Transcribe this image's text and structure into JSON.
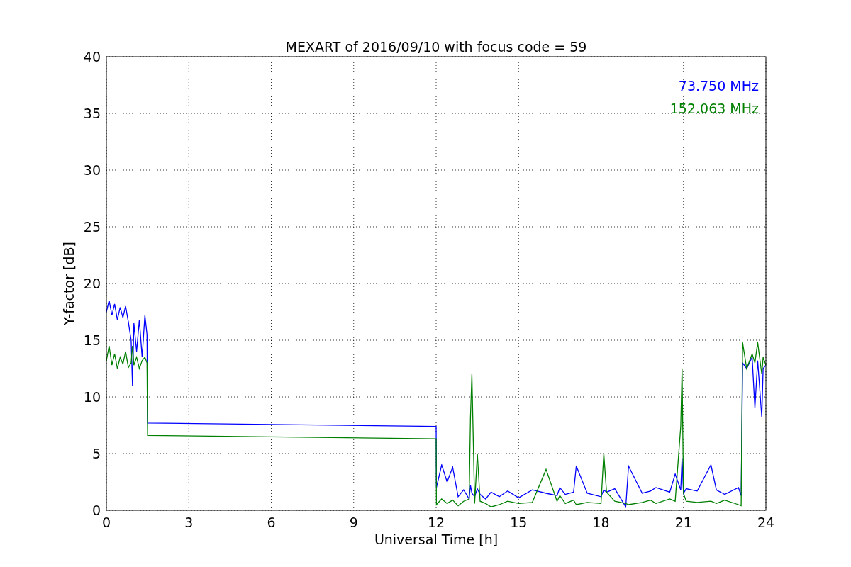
{
  "figure": {
    "chart_data": {
      "type": "line",
      "title": "MEXART of 2016/09/10 with focus code = 59",
      "xlabel": "Universal Time [h]",
      "ylabel": "Y-factor [dB]",
      "grid": true,
      "xlim": [
        0,
        24
      ],
      "ylim": [
        0,
        40
      ],
      "xticks": [
        0,
        3,
        6,
        9,
        12,
        15,
        18,
        21,
        24
      ],
      "yticks": [
        0,
        5,
        10,
        15,
        20,
        25,
        30,
        35,
        40
      ],
      "x": [
        0,
        0.1,
        0.2,
        0.3,
        0.4,
        0.5,
        0.6,
        0.7,
        0.8,
        0.9,
        0.95,
        1.0,
        1.1,
        1.2,
        1.3,
        1.4,
        1.48,
        1.5,
        12.0,
        12.01,
        12.2,
        12.4,
        12.6,
        12.8,
        13.0,
        13.2,
        13.25,
        13.3,
        13.4,
        13.5,
        13.6,
        13.8,
        14.0,
        14.3,
        14.6,
        15.0,
        15.5,
        16.0,
        16.4,
        16.5,
        16.7,
        17.0,
        17.1,
        17.5,
        18.0,
        18.1,
        18.2,
        18.5,
        18.9,
        19.0,
        19.5,
        19.8,
        20.0,
        20.5,
        20.7,
        20.9,
        20.95,
        21.0,
        21.1,
        21.5,
        22.0,
        22.2,
        22.5,
        23.0,
        23.1,
        23.15,
        23.3,
        23.5,
        23.6,
        23.7,
        23.85,
        23.9,
        24
      ],
      "series": [
        {
          "name": "73.750 MHz",
          "color": "#0000ff",
          "values": [
            17.5,
            18.5,
            17.2,
            18.2,
            16.8,
            17.9,
            17.0,
            18.0,
            16.6,
            15.0,
            11.0,
            16.5,
            14.0,
            16.8,
            13.5,
            17.2,
            15.5,
            7.7,
            7.4,
            2.0,
            4.0,
            2.5,
            3.8,
            1.2,
            1.8,
            1.0,
            2.2,
            1.5,
            1.2,
            1.9,
            1.4,
            1.0,
            1.6,
            1.2,
            1.7,
            1.1,
            1.8,
            1.5,
            1.3,
            2.0,
            1.4,
            1.6,
            3.9,
            1.5,
            1.2,
            1.8,
            1.6,
            1.9,
            0.3,
            3.9,
            1.5,
            1.7,
            2.0,
            1.6,
            3.2,
            1.8,
            4.6,
            1.5,
            1.9,
            1.7,
            4.0,
            1.8,
            1.4,
            2.0,
            1.3,
            13.0,
            12.5,
            13.5,
            9.0,
            13.2,
            8.2,
            12.5,
            12.8
          ]
        },
        {
          "name": "152.063 MHz",
          "color": "#008000",
          "values": [
            13.2,
            14.5,
            12.8,
            13.8,
            12.5,
            13.5,
            12.9,
            14.0,
            12.6,
            13.0,
            14.5,
            12.8,
            13.5,
            12.5,
            13.2,
            13.5,
            13.0,
            6.6,
            6.3,
            0.5,
            1.0,
            0.6,
            0.9,
            0.4,
            0.8,
            1.0,
            8.2,
            12.0,
            0.6,
            5.0,
            0.8,
            0.6,
            0.3,
            0.5,
            0.8,
            0.6,
            0.7,
            3.6,
            0.8,
            1.3,
            0.6,
            0.9,
            0.5,
            0.7,
            0.6,
            5.0,
            1.6,
            0.8,
            0.6,
            0.5,
            0.7,
            0.9,
            0.6,
            1.0,
            0.8,
            7.4,
            12.5,
            1.5,
            0.8,
            0.7,
            0.8,
            0.6,
            0.9,
            0.5,
            0.4,
            14.8,
            12.5,
            13.8,
            13.0,
            14.8,
            12.0,
            13.5,
            12.8
          ]
        }
      ]
    }
  }
}
